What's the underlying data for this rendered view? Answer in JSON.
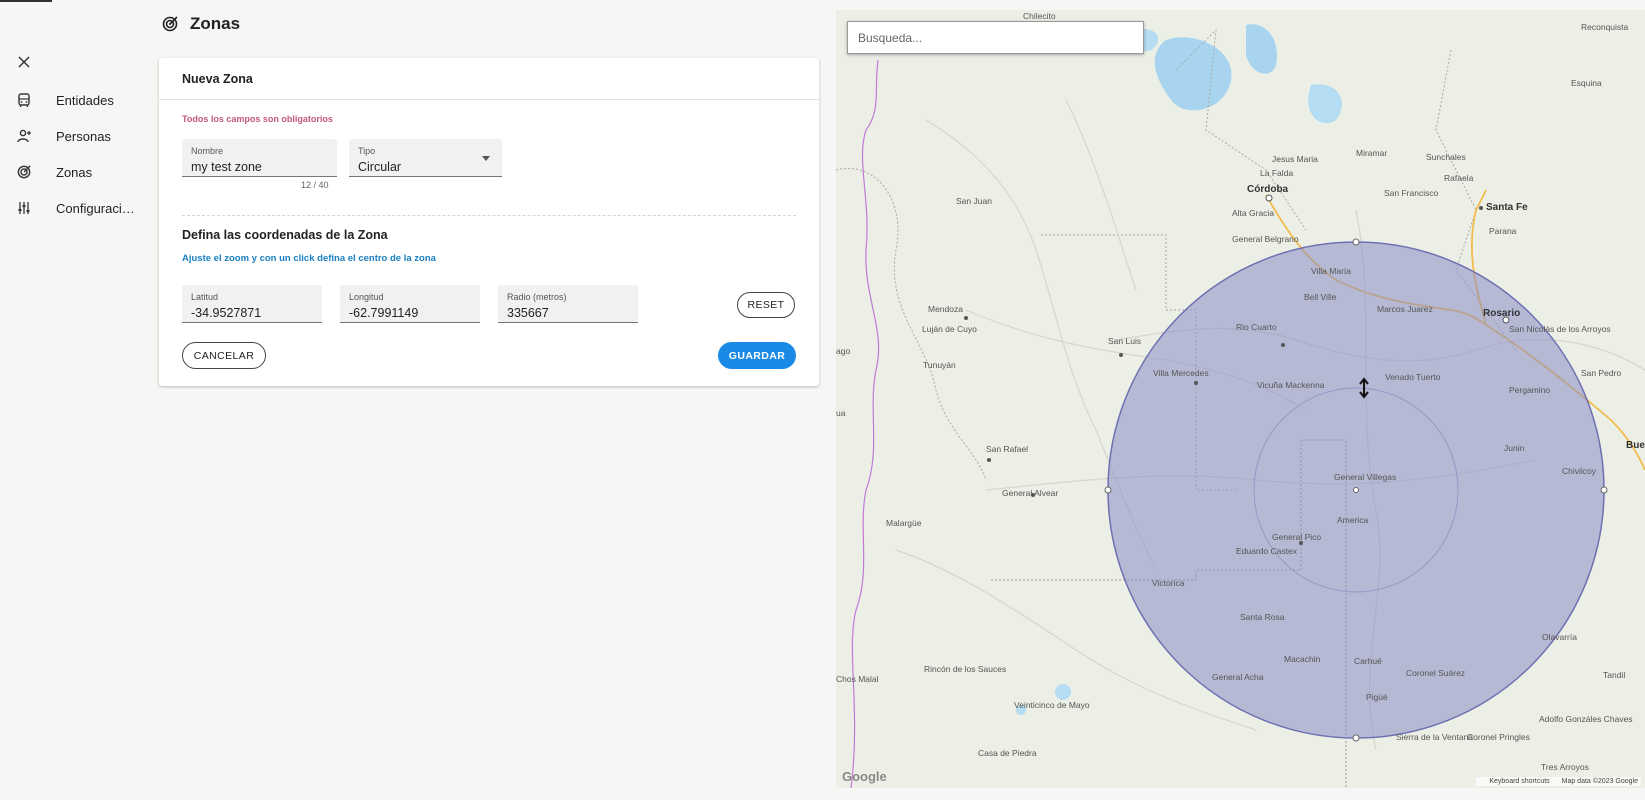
{
  "header": {
    "title": "Zonas"
  },
  "sidebar": {
    "items": [
      {
        "label": "Entidades",
        "icon": "car-icon"
      },
      {
        "label": "Personas",
        "icon": "person-add-icon"
      },
      {
        "label": "Zonas",
        "icon": "zones-icon"
      },
      {
        "label": "Configuracio...",
        "icon": "sliders-icon"
      }
    ]
  },
  "form": {
    "title": "Nueva Zona",
    "required_note": "Todos los campos son obligatorios",
    "nombre": {
      "label": "Nombre",
      "value": "my test zone",
      "counter": "12 / 40"
    },
    "tipo": {
      "label": "Tipo",
      "value": "Circular"
    },
    "section_title": "Defina las coordenadas de la Zona",
    "hint": "Ajuste el zoom y con un click defina el centro de la zona",
    "latitud": {
      "label": "Latitud",
      "value": "-34.9527871"
    },
    "longitud": {
      "label": "Longitud",
      "value": "-62.7991149"
    },
    "radio": {
      "label": "Radio (metros)",
      "value": "335667"
    },
    "reset_label": "RESET",
    "cancel_label": "CANCELAR",
    "save_label": "GUARDAR"
  },
  "map": {
    "search_placeholder": "Busqueda...",
    "logo": "Google",
    "shortcuts": "Keyboard shortcuts",
    "map_data": "Map data ©2023 Google",
    "zone_fill": "#8b8cc4",
    "zone_stroke": "#6e70b2",
    "labels": {
      "cordoba": "Córdoba",
      "rosario": "Rosario",
      "santa_fe": "Santa Fe",
      "parana": "Parana",
      "mendoza": "Mendoza",
      "san_luis": "San Luis",
      "rio_cuarto": "Rio Cuarto",
      "villa_mercedes": "Villa Mercedes",
      "san_rafael": "San Rafael",
      "general_alvear": "General Alvear",
      "general_villegas": "General Villegas",
      "general_pico": "General Pico",
      "santa_rosa": "Santa Rosa",
      "victorica": "Victorica",
      "venado_tuerto": "Venado Tuerto",
      "pergamino": "Pergamino",
      "junin": "Junin",
      "san_juan": "San Juan",
      "malargue": "Malargüe",
      "bell_ville": "Bell Ville",
      "villa_maria": "Villa María",
      "marcos_juarez": "Marcos Juarez",
      "tunuyan": "Tunuyán",
      "lujan_de_cuyo": "Luján de Cuyo",
      "san_francisco": "San Francisco",
      "miramar": "Miramar",
      "jesus_maria": "Jesus Maria",
      "la_falda": "La Falda",
      "alta_gracia": "Alta Gracia",
      "general_belgrano": "General Belgrano",
      "chilecito": "Chilecito",
      "reconquista": "Reconquista",
      "esquina": "Esquina",
      "sunchales": "Sunchales",
      "rafaela": "Rafaela",
      "san_nicolas": "San Nicolás de los Arroyos",
      "san_pedro": "San Pedro",
      "chivilcoy": "Chivilcoy",
      "olavarria": "Olavarría",
      "tandil": "Tandil",
      "america": "America",
      "eduardo_castex": "Eduardo Castex",
      "macachin": "Macachin",
      "carhue": "Carhué",
      "coronel_suarez": "Coronel Suárez",
      "pigue": "Pigüé",
      "general_acha": "General Acha",
      "rincon_de_los_sauces": "Rincón de los Sauces",
      "veinticinco_de_mayo": "Veinticinco de Mayo",
      "casa_de_piedra": "Casa de Piedra",
      "chos_malal": "Chos Malal",
      "sierra_de_la_ventana": "Sierra de la Ventana",
      "coronel_pringles": "Coronel Pringles",
      "tres_arroyos": "Tres Arroyos",
      "adolfo_gonzales_chaves": "Adolfo Gonzáles Chaves",
      "vicuna_mackenna": "Vicuña Mackenna",
      "santiago_partial": "ago",
      "bue_partial": "Bue",
      "ua_partial": "ua"
    }
  }
}
